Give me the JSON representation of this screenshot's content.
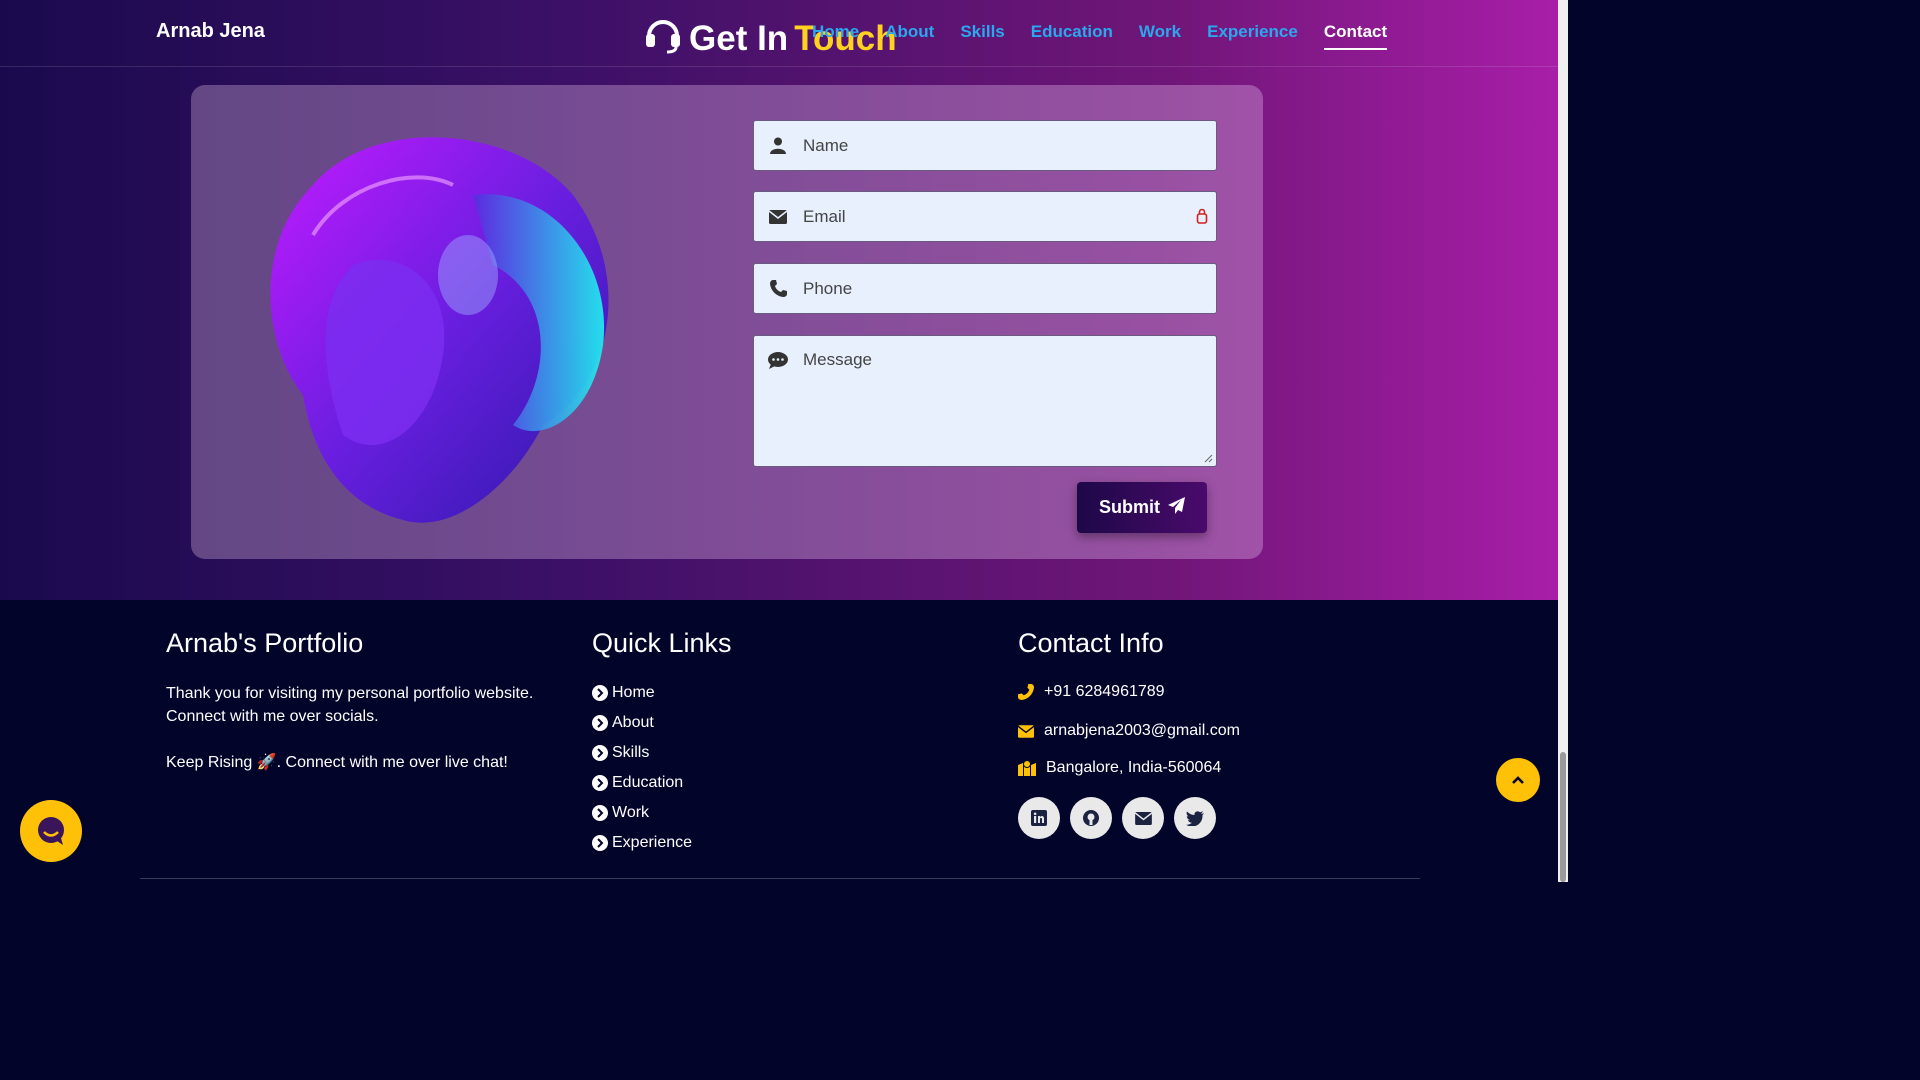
{
  "navbar": {
    "brand": "Arnab Jena",
    "links": [
      {
        "label": "Home"
      },
      {
        "label": "About"
      },
      {
        "label": "Skills"
      },
      {
        "label": "Education"
      },
      {
        "label": "Work"
      },
      {
        "label": "Experience"
      },
      {
        "label": "Contact",
        "active": true
      }
    ]
  },
  "section": {
    "heading_part1": "Get In",
    "heading_part2": "Touch",
    "heading_icon": "headset-icon"
  },
  "form": {
    "name_placeholder": "Name",
    "email_placeholder": "Email",
    "phone_placeholder": "Phone",
    "message_placeholder": "Message",
    "submit_label": "Submit"
  },
  "footer": {
    "about_title": "Arnab's Portfolio",
    "about_text": "Thank you for visiting my personal portfolio website. Connect with me over socials.",
    "about_text2": "Keep Rising 🚀. Connect with me over live chat!",
    "links_title": "Quick Links",
    "links": [
      "Home",
      "About",
      "Skills",
      "Education",
      "Work",
      "Experience"
    ],
    "contact_title": "Contact Info",
    "phone": "+91 6284961789",
    "email": "arnabjena2003@gmail.com",
    "address": "Bangalore, India-560064",
    "socials": [
      "linkedin-icon",
      "github-icon",
      "envelope-icon",
      "twitter-icon"
    ]
  },
  "colors": {
    "accent": "#ffd21f",
    "nav_link": "#2aa7ee",
    "footer_bg": "#02042a",
    "fab": "#ffc107"
  }
}
